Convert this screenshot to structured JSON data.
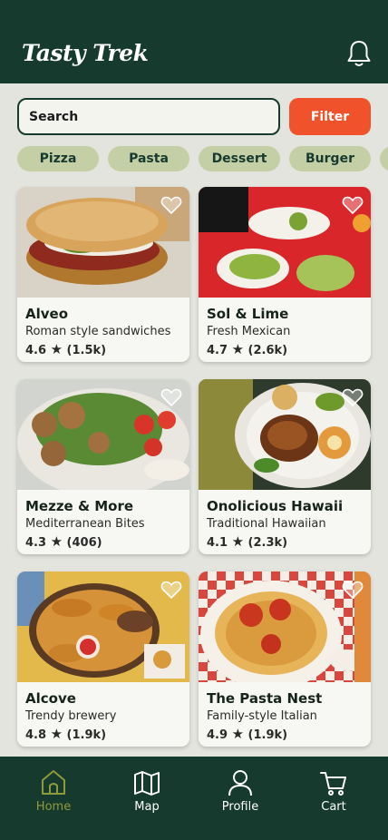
{
  "header": {
    "app_title": "Tasty Trek"
  },
  "search": {
    "placeholder": "Search",
    "filter_label": "Filter"
  },
  "categories": [
    "Pizza",
    "Pasta",
    "Dessert",
    "Burger",
    ""
  ],
  "restaurants": [
    {
      "name": "Alveo",
      "description": "Roman style sandwiches",
      "rating": "4.6",
      "reviews": "(1.5k)"
    },
    {
      "name": "Sol & Lime",
      "description": "Fresh Mexican",
      "rating": "4.7",
      "reviews": "(2.6k)"
    },
    {
      "name": "Mezze & More",
      "description": "Mediterranean Bites",
      "rating": "4.3",
      "reviews": "(406)"
    },
    {
      "name": "Onolicious Hawaii",
      "description": "Traditional Hawaiian",
      "rating": "4.1",
      "reviews": "(2.3k)"
    },
    {
      "name": "Alcove",
      "description": "Trendy brewery",
      "rating": "4.8",
      "reviews": "(1.9k)"
    },
    {
      "name": "The Pasta Nest",
      "description": "Family-style Italian",
      "rating": "4.9",
      "reviews": "(1.9k)"
    }
  ],
  "nav": [
    {
      "label": "Home",
      "icon": "home-icon",
      "active": true
    },
    {
      "label": "Map",
      "icon": "map-icon",
      "active": false
    },
    {
      "label": "Profile",
      "icon": "profile-icon",
      "active": false
    },
    {
      "label": "Cart",
      "icon": "cart-icon",
      "active": false
    }
  ],
  "colors": {
    "header_bg": "#173a2f",
    "filter_bg": "#f0532b",
    "chip_bg": "#c5cfa6",
    "active_nav": "#8f9a3a",
    "page_bg": "#e4e4de"
  }
}
